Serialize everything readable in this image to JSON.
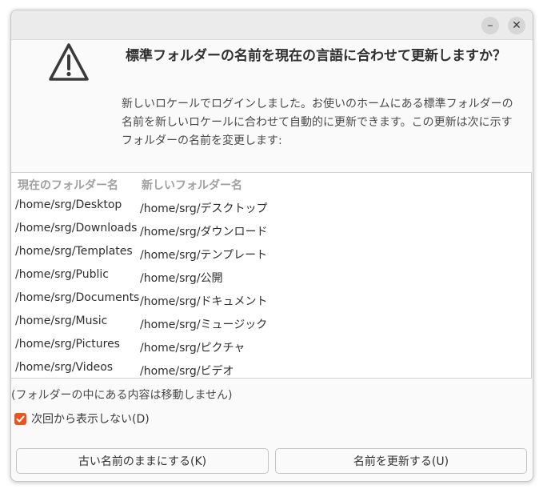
{
  "window": {
    "minimize_label": "–",
    "close_label": "✕"
  },
  "heading": "標準フォルダーの名前を現在の言語に合わせて更新しますか？",
  "body_text": "新しいロケールでログインしました。お使いのホームにある標準フォルダーの名前を新しいロケールに合わせて自動的に更新できます。この更新は次に示すフォルダーの名前を変更します:",
  "table": {
    "columns": [
      "現在のフォルダー名",
      "新しいフォルダー名"
    ],
    "rows": [
      {
        "old": "/home/srg/Desktop",
        "new": "/home/srg/デスクトップ"
      },
      {
        "old": "/home/srg/Downloads",
        "new": "/home/srg/ダウンロード"
      },
      {
        "old": "/home/srg/Templates",
        "new": "/home/srg/テンプレート"
      },
      {
        "old": "/home/srg/Public",
        "new": "/home/srg/公開"
      },
      {
        "old": "/home/srg/Documents",
        "new": "/home/srg/ドキュメント"
      },
      {
        "old": "/home/srg/Music",
        "new": "/home/srg/ミュージック"
      },
      {
        "old": "/home/srg/Pictures",
        "new": "/home/srg/ピクチャ"
      },
      {
        "old": "/home/srg/Videos",
        "new": "/home/srg/ビデオ"
      }
    ]
  },
  "note": "(フォルダーの中にある内容は移動しません)",
  "checkbox": {
    "label": "次回から表示しない(D)",
    "checked": true
  },
  "buttons": {
    "keep": "古い名前のままにする(K)",
    "update": "名前を更新する(U)"
  },
  "colors": {
    "accent": "#e95420"
  },
  "icons": {
    "warning": "warning-icon",
    "checkmark": "checkmark-icon"
  }
}
